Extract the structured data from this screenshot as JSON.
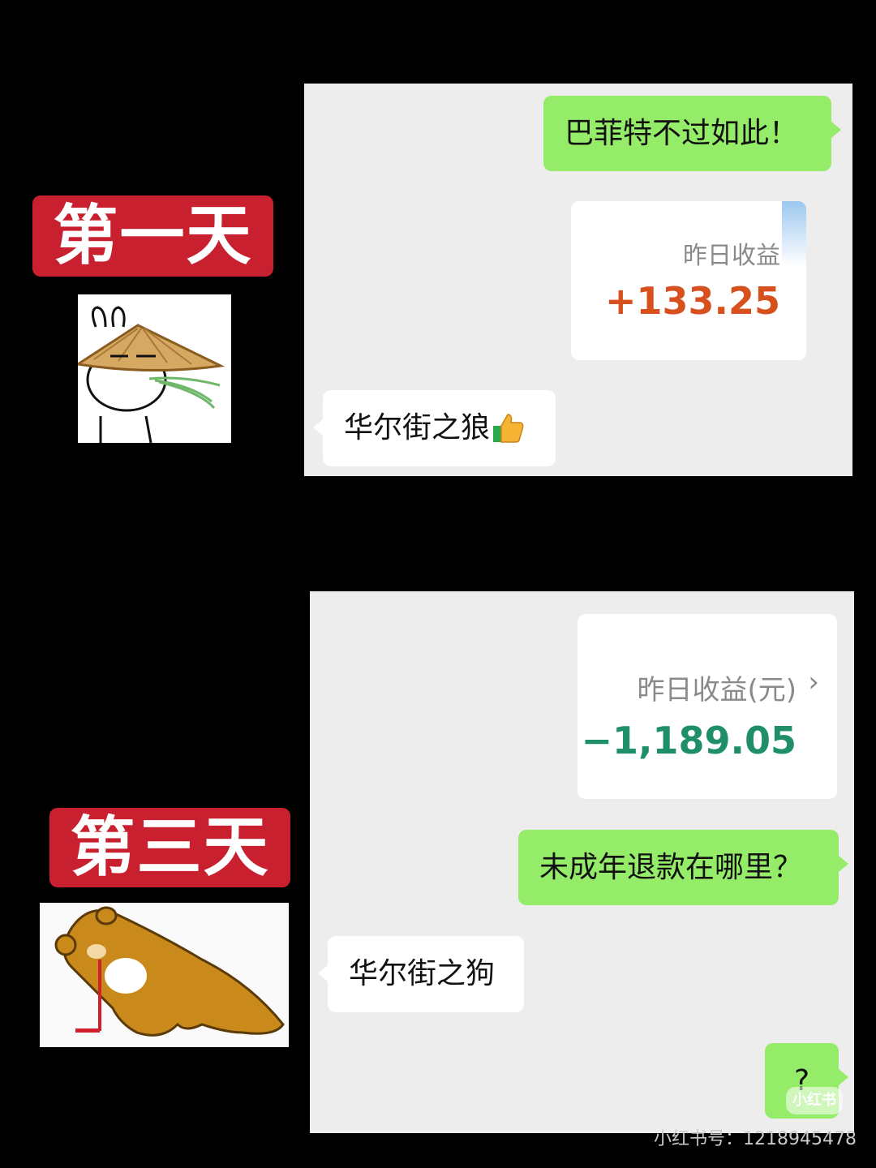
{
  "day1": {
    "label": "第一天",
    "chat": {
      "msg_sent": "巴菲特不过如此！",
      "card": {
        "label": "昨日收益",
        "value": "+133.25",
        "value_color": "#d6511d"
      },
      "msg_received": "华尔街之狼"
    }
  },
  "day3": {
    "label": "第三天",
    "chat": {
      "card": {
        "label": "昨日收益(元)",
        "value": "−1,189.05",
        "value_color": "#1f8f6a"
      },
      "msg_sent": "未成年退款在哪里？",
      "msg_received": "华尔街之狗",
      "msg_sent_2": "?"
    }
  },
  "watermark": {
    "corner": "小红书",
    "bottom": "小红书号：1218945478"
  },
  "colors": {
    "label_bg": "#c8202f",
    "bubble_green": "#95ec69",
    "chat_bg": "#ededed"
  }
}
